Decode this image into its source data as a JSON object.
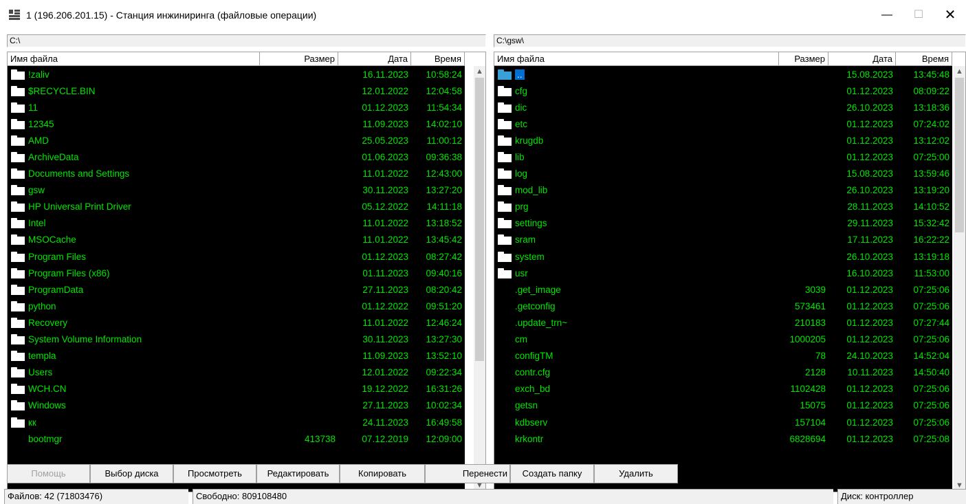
{
  "window": {
    "title": "1 (196.206.201.15) - Станция инжиниринга (файловые операции)",
    "min_symbol": "—",
    "max_symbol": "☐",
    "close_symbol": "✕"
  },
  "colors": {
    "grid_bg": "#000000",
    "grid_text": "#00e600",
    "selection": "#0070d0"
  },
  "left": {
    "path": "C:\\",
    "columns": {
      "name": "Имя файла",
      "size": "Размер",
      "date": "Дата",
      "time": "Время"
    },
    "rows": [
      {
        "type": "folder",
        "name": "!zaliv",
        "size": "",
        "date": "16.11.2023",
        "time": "10:58:24"
      },
      {
        "type": "folder",
        "name": "$RECYCLE.BIN",
        "size": "",
        "date": "12.01.2022",
        "time": "12:04:58"
      },
      {
        "type": "folder",
        "name": "11",
        "size": "",
        "date": "01.12.2023",
        "time": "11:54:34"
      },
      {
        "type": "folder",
        "name": "12345",
        "size": "",
        "date": "11.09.2023",
        "time": "14:02:10"
      },
      {
        "type": "folder",
        "name": "AMD",
        "size": "",
        "date": "25.05.2023",
        "time": "11:00:12"
      },
      {
        "type": "folder",
        "name": "ArchiveData",
        "size": "",
        "date": "01.06.2023",
        "time": "09:36:38"
      },
      {
        "type": "folder",
        "name": "Documents and Settings",
        "size": "",
        "date": "11.01.2022",
        "time": "12:43:00"
      },
      {
        "type": "folder",
        "name": "gsw",
        "size": "",
        "date": "30.11.2023",
        "time": "13:27:20"
      },
      {
        "type": "folder",
        "name": "HP Universal Print Driver",
        "size": "",
        "date": "05.12.2022",
        "time": "14:11:18"
      },
      {
        "type": "folder",
        "name": "Intel",
        "size": "",
        "date": "11.01.2022",
        "time": "13:18:52"
      },
      {
        "type": "folder",
        "name": "MSOCache",
        "size": "",
        "date": "11.01.2022",
        "time": "13:45:42"
      },
      {
        "type": "folder",
        "name": "Program Files",
        "size": "",
        "date": "01.12.2023",
        "time": "08:27:42"
      },
      {
        "type": "folder",
        "name": "Program Files (x86)",
        "size": "",
        "date": "01.11.2023",
        "time": "09:40:16"
      },
      {
        "type": "folder",
        "name": "ProgramData",
        "size": "",
        "date": "27.11.2023",
        "time": "08:20:42"
      },
      {
        "type": "folder",
        "name": "python",
        "size": "",
        "date": "01.12.2022",
        "time": "09:51:20"
      },
      {
        "type": "folder",
        "name": "Recovery",
        "size": "",
        "date": "11.01.2022",
        "time": "12:46:24"
      },
      {
        "type": "folder",
        "name": "System Volume Information",
        "size": "",
        "date": "30.11.2023",
        "time": "13:27:30"
      },
      {
        "type": "folder",
        "name": "templa",
        "size": "",
        "date": "11.09.2023",
        "time": "13:52:10"
      },
      {
        "type": "folder",
        "name": "Users",
        "size": "",
        "date": "12.01.2022",
        "time": "09:22:34"
      },
      {
        "type": "folder",
        "name": "WCH.CN",
        "size": "",
        "date": "19.12.2022",
        "time": "16:31:26"
      },
      {
        "type": "folder",
        "name": "Windows",
        "size": "",
        "date": "27.11.2023",
        "time": "10:02:34"
      },
      {
        "type": "folder",
        "name": "кк",
        "size": "",
        "date": "24.11.2023",
        "time": "16:49:58"
      },
      {
        "type": "file",
        "name": "bootmgr",
        "size": "413738",
        "date": "07.12.2019",
        "time": "12:09:00"
      }
    ]
  },
  "right": {
    "path": "C:\\gsw\\",
    "columns": {
      "name": "Имя файла",
      "size": "Размер",
      "date": "Дата",
      "time": "Время"
    },
    "rows": [
      {
        "type": "parent",
        "name": "..",
        "size": "",
        "date": "15.08.2023",
        "time": "13:45:48"
      },
      {
        "type": "folder",
        "name": "cfg",
        "size": "",
        "date": "01.12.2023",
        "time": "08:09:22"
      },
      {
        "type": "folder",
        "name": "dic",
        "size": "",
        "date": "26.10.2023",
        "time": "13:18:36"
      },
      {
        "type": "folder",
        "name": "etc",
        "size": "",
        "date": "01.12.2023",
        "time": "07:24:02"
      },
      {
        "type": "folder",
        "name": "krugdb",
        "size": "",
        "date": "01.12.2023",
        "time": "13:12:02"
      },
      {
        "type": "folder",
        "name": "lib",
        "size": "",
        "date": "01.12.2023",
        "time": "07:25:00"
      },
      {
        "type": "folder",
        "name": "log",
        "size": "",
        "date": "15.08.2023",
        "time": "13:59:46"
      },
      {
        "type": "folder",
        "name": "mod_lib",
        "size": "",
        "date": "26.10.2023",
        "time": "13:19:20"
      },
      {
        "type": "folder",
        "name": "prg",
        "size": "",
        "date": "28.11.2023",
        "time": "14:10:52"
      },
      {
        "type": "folder",
        "name": "settings",
        "size": "",
        "date": "29.11.2023",
        "time": "15:32:42"
      },
      {
        "type": "folder",
        "name": "sram",
        "size": "",
        "date": "17.11.2023",
        "time": "16:22:22"
      },
      {
        "type": "folder",
        "name": "system",
        "size": "",
        "date": "26.10.2023",
        "time": "13:19:18"
      },
      {
        "type": "folder",
        "name": "usr",
        "size": "",
        "date": "16.10.2023",
        "time": "11:53:00"
      },
      {
        "type": "file",
        "name": ".get_image",
        "size": "3039",
        "date": "01.12.2023",
        "time": "07:25:06"
      },
      {
        "type": "file",
        "name": ".getconfig",
        "size": "573461",
        "date": "01.12.2023",
        "time": "07:25:06"
      },
      {
        "type": "file",
        "name": ".update_trn~",
        "size": "210183",
        "date": "01.12.2023",
        "time": "07:27:44"
      },
      {
        "type": "file",
        "name": "cm",
        "size": "1000205",
        "date": "01.12.2023",
        "time": "07:25:06"
      },
      {
        "type": "file",
        "name": "configTM",
        "size": "78",
        "date": "24.10.2023",
        "time": "14:52:04"
      },
      {
        "type": "file",
        "name": "contr.cfg",
        "size": "2128",
        "date": "10.11.2023",
        "time": "14:50:40"
      },
      {
        "type": "file",
        "name": "exch_bd",
        "size": "1102428",
        "date": "01.12.2023",
        "time": "07:25:06"
      },
      {
        "type": "file",
        "name": "getsn",
        "size": "15075",
        "date": "01.12.2023",
        "time": "07:25:06"
      },
      {
        "type": "file",
        "name": "kdbserv",
        "size": "157104",
        "date": "01.12.2023",
        "time": "07:25:06"
      },
      {
        "type": "file",
        "name": "krkontr",
        "size": "6828694",
        "date": "01.12.2023",
        "time": "07:25:08"
      }
    ]
  },
  "toolbar": {
    "help": "Помощь",
    "select_disk": "Выбор диска",
    "view": "Просмотреть",
    "edit": "Редактировать",
    "copy": "Копировать",
    "move": "Перенести",
    "mkdir": "Создать папку",
    "delete": "Удалить"
  },
  "status": {
    "files": "Файлов: 42 (71803476)",
    "free": "Свободно: 809108480",
    "disk": "Диск: контроллер"
  },
  "scroll": {
    "left_position": 0,
    "right_position": 0
  }
}
